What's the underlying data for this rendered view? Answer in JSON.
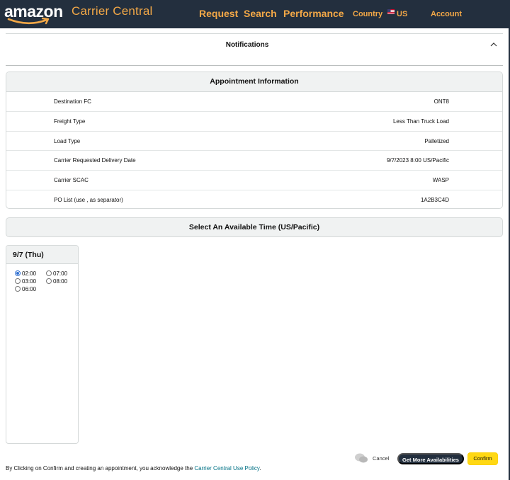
{
  "nav": {
    "logo_text": "amazon",
    "brand_sub": "Carrier Central",
    "links": {
      "request": "Request",
      "search": "Search",
      "performance": "Performance",
      "country": "Country",
      "region": "US",
      "account": "Account"
    }
  },
  "notifications": {
    "title": "Notifications"
  },
  "appointment": {
    "title": "Appointment Information",
    "rows": [
      {
        "label": "Destination FC",
        "value": "ONT8"
      },
      {
        "label": "Freight Type",
        "value": "Less Than Truck Load"
      },
      {
        "label": "Load Type",
        "value": "Palletized"
      },
      {
        "label": "Carrier Requested Delivery Date",
        "value": "9/7/2023 8:00 US/Pacific"
      },
      {
        "label": "Carrier SCAC",
        "value": "WASP"
      },
      {
        "label": "PO List (use , as separator)",
        "value": "1A2B3C4D"
      }
    ]
  },
  "select_time": {
    "title": "Select An Available Time (US/Pacific)"
  },
  "day": {
    "label": "9/7 (Thu)",
    "slots": [
      "02:00",
      "07:00",
      "03:00",
      "08:00",
      "06:00"
    ],
    "selected": "02:00"
  },
  "footer": {
    "text": "By Clicking on Confirm and creating an appointment, you acknowledge the ",
    "link": "Carrier Central Use Policy",
    "end": "."
  },
  "actions": {
    "cancel": "Cancel",
    "more": "Get More Availabilities",
    "confirm": "Confirm"
  },
  "colors": {
    "nav_bg": "#232f3e",
    "nav_accent": "#f3a847",
    "confirm_bg": "#ffd814",
    "link": "#007185"
  }
}
